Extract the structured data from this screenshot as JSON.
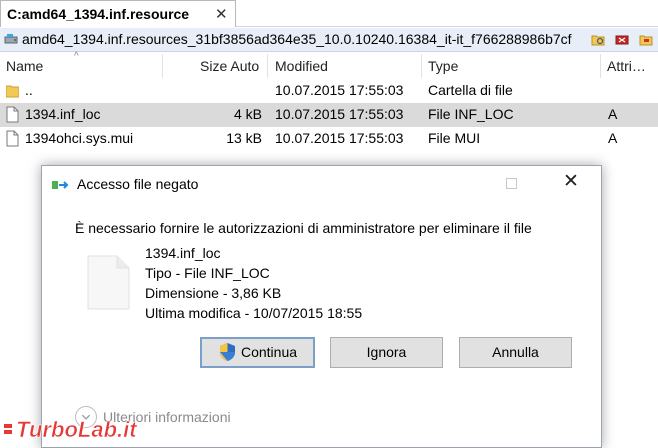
{
  "tab": {
    "title": "C:amd64_1394.inf.resource",
    "close_glyph": "✕"
  },
  "path": {
    "text": "amd64_1394.inf.resources_31bf3856ad364e35_10.0.10240.16384_it-it_f766288986b7cf"
  },
  "columns": {
    "name": "Name",
    "size": "Size Auto",
    "modified": "Modified",
    "type": "Type",
    "attributes": "Attri…"
  },
  "rows": [
    {
      "name": "..",
      "size": "",
      "modified": "10.07.2015 17:55:03",
      "type": "Cartella di file",
      "attr": "",
      "icon": "folder-icon"
    },
    {
      "name": "1394.inf_loc",
      "size": "4 kB",
      "modified": "10.07.2015 17:55:03",
      "type": "File INF_LOC",
      "attr": "A",
      "icon": "file-icon",
      "selected": true
    },
    {
      "name": "1394ohci.sys.mui",
      "size": "13 kB",
      "modified": "10.07.2015 17:55:03",
      "type": "File MUI",
      "attr": "A",
      "icon": "file-icon"
    }
  ],
  "dialog": {
    "title": "Accesso file negato",
    "message": "È necessario fornire le autorizzazioni di amministratore per eliminare il file",
    "file_name": "1394.inf_loc",
    "file_type": "Tipo - File INF_LOC",
    "file_size": "Dimensione - 3,86 KB",
    "file_modified": "Ultima modifica - 10/07/2015 18:55",
    "continue_label": "Continua",
    "ignore_label": "Ignora",
    "cancel_label": "Annulla",
    "more_info_label": "Ulteriori informazioni"
  },
  "colors": {
    "selected_row": "#dadada",
    "path_bar": "#e8eef7",
    "button_face": "#e1e1e1",
    "default_button_border": "#7a9fc9"
  }
}
